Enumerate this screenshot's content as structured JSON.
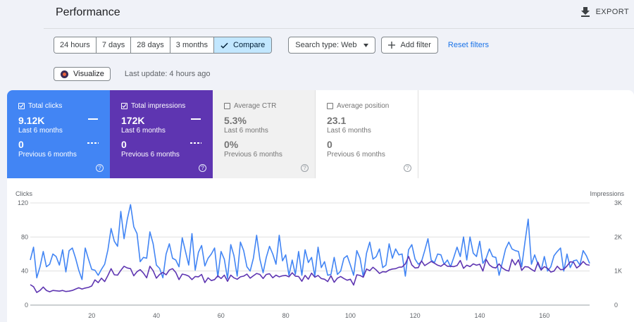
{
  "header": {
    "title": "Performance",
    "export_label": "EXPORT"
  },
  "filters": {
    "ranges": [
      "24 hours",
      "7 days",
      "28 days",
      "3 months"
    ],
    "compare_label": "Compare",
    "search_type_label": "Search type: Web",
    "add_filter_label": "Add filter",
    "reset_label": "Reset filters"
  },
  "visualize": {
    "label": "Visualize",
    "last_update": "Last update: 4 hours ago"
  },
  "metrics": {
    "clicks": {
      "label": "Total clicks",
      "value": "9.12K",
      "period": "Last 6 months",
      "prev_value": "0",
      "prev_period": "Previous 6 months",
      "checked": true,
      "color": "#4285f4"
    },
    "impressions": {
      "label": "Total impressions",
      "value": "172K",
      "period": "Last 6 months",
      "prev_value": "0",
      "prev_period": "Previous 6 months",
      "checked": true,
      "color": "#5e35b1"
    },
    "ctr": {
      "label": "Average CTR",
      "value": "5.3%",
      "period": "Last 6 months",
      "prev_value": "0%",
      "prev_period": "Previous 6 months",
      "checked": false
    },
    "position": {
      "label": "Average position",
      "value": "23.1",
      "period": "Last 6 months",
      "prev_value": "0",
      "prev_period": "Previous 6 months",
      "checked": false
    }
  },
  "chart_data": {
    "type": "line",
    "left_axis_label": "Clicks",
    "right_axis_label": "Impressions",
    "y_left_ticks": [
      "120",
      "80",
      "40",
      "0"
    ],
    "y_right_ticks": [
      "3K",
      "2K",
      "1K",
      "0"
    ],
    "ylim_left": [
      0,
      120
    ],
    "ylim_right": [
      0,
      3000
    ],
    "x_ticks": [
      "20",
      "40",
      "60",
      "80",
      "100",
      "120",
      "140",
      "160"
    ],
    "xlim": [
      1,
      174
    ],
    "grid": true,
    "series": [
      {
        "name": "Clicks",
        "color": "#4285f4",
        "values": [
          53,
          68,
          32,
          45,
          63,
          45,
          48,
          60,
          57,
          47,
          65,
          39,
          64,
          67,
          55,
          41,
          30,
          67,
          54,
          42,
          41,
          35,
          42,
          48,
          65,
          90,
          75,
          69,
          110,
          78,
          101,
          118,
          92,
          84,
          51,
          56,
          55,
          86,
          72,
          47,
          43,
          32,
          60,
          72,
          55,
          53,
          45,
          79,
          63,
          47,
          84,
          41,
          62,
          70,
          46,
          55,
          60,
          67,
          33,
          63,
          54,
          31,
          71,
          58,
          34,
          74,
          64,
          45,
          40,
          55,
          82,
          54,
          38,
          56,
          69,
          60,
          48,
          82,
          52,
          59,
          35,
          53,
          36,
          63,
          35,
          65,
          50,
          56,
          34,
          68,
          44,
          51,
          35,
          36,
          56,
          36,
          40,
          55,
          58,
          47,
          35,
          64,
          55,
          33,
          61,
          74,
          54,
          57,
          66,
          44,
          47,
          72,
          55,
          66,
          59,
          60,
          34,
          65,
          71,
          54,
          48,
          51,
          64,
          78,
          53,
          50,
          60,
          59,
          48,
          53,
          45,
          56,
          68,
          57,
          80,
          53,
          80,
          61,
          57,
          75,
          49,
          55,
          66,
          57,
          56,
          35,
          50,
          66,
          74,
          66,
          64,
          63,
          45,
          74,
          101,
          48,
          59,
          48,
          41,
          57,
          40,
          45,
          58,
          63,
          67,
          40,
          60,
          44,
          52,
          53,
          47,
          64,
          58,
          49
        ]
      },
      {
        "name": "Impressions",
        "color": "#5e35b1",
        "values": [
          600,
          540,
          370,
          430,
          530,
          430,
          390,
          430,
          420,
          410,
          430,
          400,
          410,
          430,
          470,
          510,
          470,
          500,
          520,
          560,
          740,
          660,
          790,
          690,
          870,
          1070,
          890,
          880,
          1020,
          1140,
          1090,
          1070,
          860,
          980,
          1040,
          940,
          800,
          1140,
          1010,
          790,
          900,
          960,
          890,
          1030,
          1070,
          960,
          750,
          910,
          890,
          850,
          750,
          840,
          830,
          900,
          660,
          800,
          720,
          750,
          860,
          780,
          880,
          700,
          880,
          800,
          760,
          830,
          850,
          910,
          790,
          860,
          930,
          900,
          780,
          900,
          920,
          800,
          880,
          830,
          860,
          870,
          830,
          950,
          850,
          840,
          700,
          870,
          760,
          940,
          820,
          870,
          780,
          760,
          690,
          860,
          670,
          790,
          840,
          780,
          730,
          760,
          590,
          890,
          870,
          820,
          1060,
          1010,
          1110,
          1030,
          930,
          980,
          970,
          1030,
          1060,
          1070,
          1110,
          1120,
          1210,
          1430,
          1180,
          1090,
          1100,
          1300,
          1160,
          1220,
          1280,
          1230,
          1170,
          1140,
          1210,
          1140,
          1140,
          1130,
          1160,
          1310,
          1080,
          1170,
          1130,
          1210,
          1170,
          1200,
          1000,
          1340,
          1180,
          1110,
          1090,
          1210,
          1090,
          1030,
          1000,
          1340,
          1180,
          1330,
          1020,
          1130,
          1120,
          1050,
          990,
          1260,
          1030,
          1130,
          1080,
          970,
          1000,
          1140,
          1040,
          1050,
          1150,
          1270,
          1260,
          1090,
          1160,
          1280,
          1190,
          1170
        ]
      }
    ]
  }
}
